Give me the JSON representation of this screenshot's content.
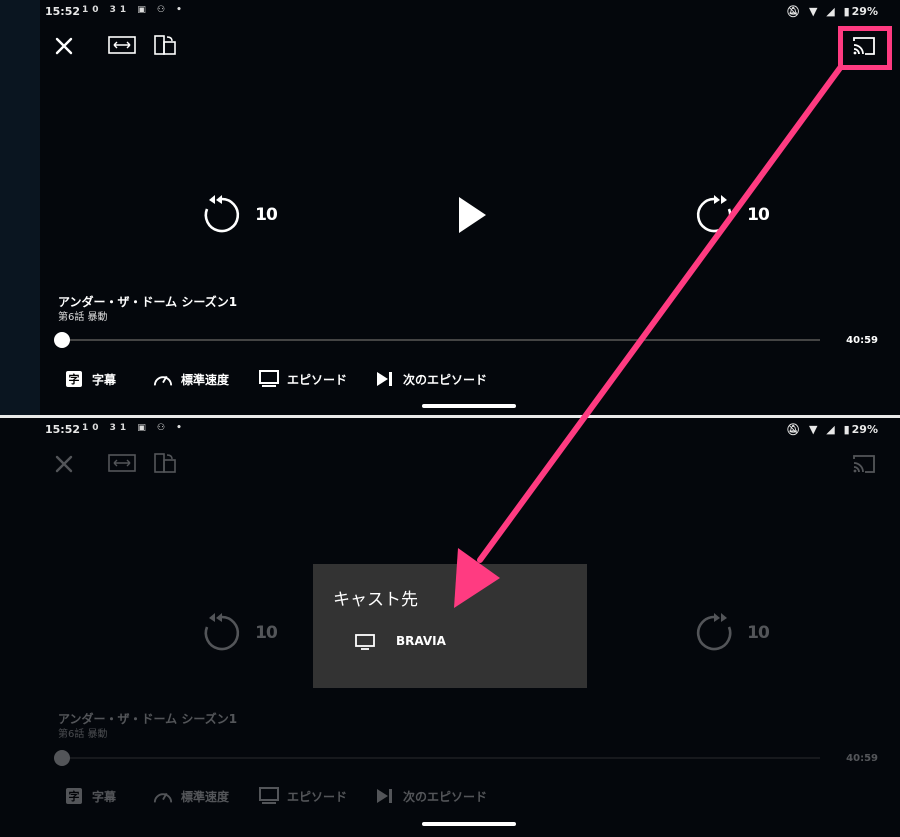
{
  "status_bar": {
    "time": "15:52",
    "notif": "10 31 ▣ ⚇ •",
    "battery": "29%"
  },
  "player": {
    "title": "アンダー・ザ・ドーム シーズン1",
    "episode": "第6話 暴動",
    "duration": "40:59",
    "skip_back": "10",
    "skip_forward": "10",
    "progress": 0
  },
  "bottom_bar": {
    "subtitles_icon": "字",
    "subtitles": "字幕",
    "speed": "標準速度",
    "episodes": "エピソード",
    "next_episode": "次のエピソード"
  },
  "cast_dialog": {
    "title": "キャスト先",
    "devices": [
      {
        "name": "BRAVIA",
        "icon": "tv-icon"
      }
    ]
  },
  "colors": {
    "highlight": "#ff3b81",
    "dialog_bg": "#333333"
  }
}
